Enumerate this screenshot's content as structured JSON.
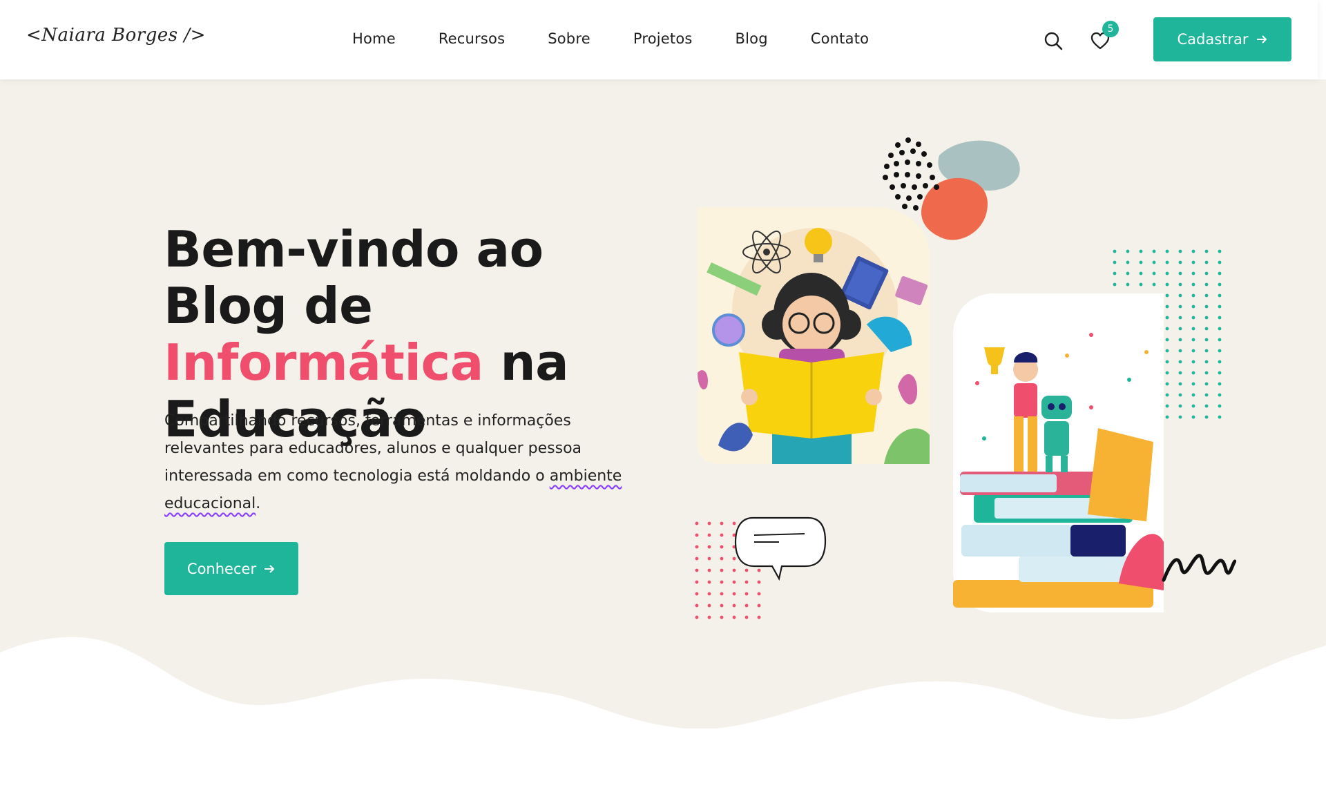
{
  "header": {
    "logo": "<Naiara Borges />",
    "nav": [
      "Home",
      "Recursos",
      "Sobre",
      "Projetos",
      "Blog",
      "Contato"
    ],
    "favorites_count": "5",
    "cta_label": "Cadastrar",
    "icons": [
      "search-icon",
      "heart-icon",
      "arrow-right-icon"
    ]
  },
  "hero": {
    "title_part1": "Bem-vindo ao Blog de ",
    "title_accent": "Informática",
    "title_part2": " na Educação",
    "description_part1": "Compartilhando recursos, ferramentas e informações relevantes para educadores, alunos e qualquer pessoa interessada em como tecnologia está moldando o ",
    "description_underlined": "ambiente educacional",
    "description_end": ".",
    "cta_label": "Conhecer"
  },
  "colors": {
    "accent_green": "#1fb59b",
    "accent_pink": "#ef4f6d",
    "hero_bg": "#f4f1ea"
  }
}
